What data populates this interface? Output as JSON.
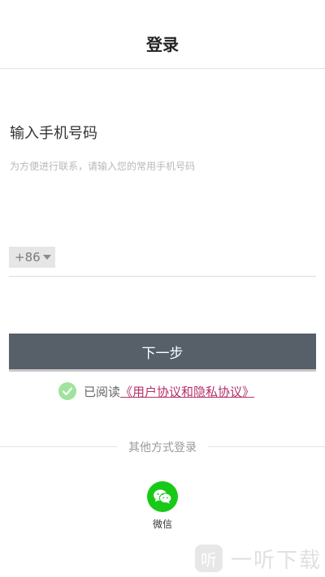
{
  "header": {
    "title": "登录"
  },
  "form": {
    "heading": "输入手机号码",
    "subtitle": "为方便进行联系，请输入您的常用手机号码",
    "country_code": "+86",
    "phone_value": "",
    "phone_placeholder": ""
  },
  "actions": {
    "next_label": "下一步"
  },
  "agreement": {
    "checked": true,
    "prefix": "已阅读",
    "link": "《用户协议和隐私协议》"
  },
  "other_login": {
    "divider_text": "其他方式登录",
    "wechat_label": "微信"
  },
  "watermark": {
    "logo_char": "听",
    "text": "一听下载"
  },
  "colors": {
    "button_bg": "#575f69",
    "link": "#b4306a",
    "check": "#9ee39e",
    "wechat": "#18c918"
  }
}
